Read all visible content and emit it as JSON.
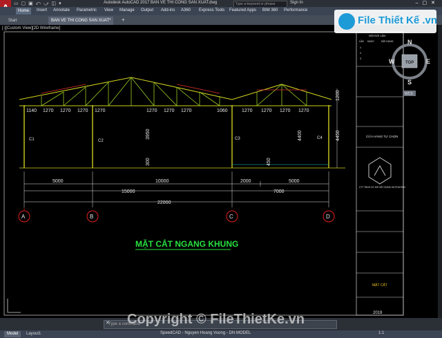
{
  "app": {
    "title": "Autodesk AutoCAD 2017   BAN VE THI CONG SAN XUAT.dwg",
    "search_placeholder": "Type a keyword or phrase",
    "signin": "Sign In",
    "logo_letter": "A"
  },
  "ribbon": {
    "tabs": [
      "Home",
      "Insert",
      "Annotate",
      "Parametric",
      "View",
      "Manage",
      "Output",
      "Add-ins",
      "A360",
      "Express Tools",
      "Featured Apps",
      "BIM 360",
      "Performance"
    ],
    "active_tab": "Home"
  },
  "doc_tabs": [
    "Start",
    "BAN VE THI CONG SAN XUAT*"
  ],
  "viewport_label": "[-][Custom View][2D Wireframe]",
  "viewcube": {
    "n": "N",
    "s": "S",
    "e": "E",
    "w": "W",
    "top": "TOP",
    "wcs": "WCS"
  },
  "drawing": {
    "heading": "MẶT CẮT NGANG KHUNG",
    "heading_color": "#28e040",
    "frame_color": "#cfcf20",
    "dim_color": "#e8e8e8",
    "axis_color": "#e02020",
    "axes": [
      "A",
      "B",
      "C",
      "D"
    ],
    "column_labels": [
      "C1",
      "C2",
      "C3",
      "C4"
    ],
    "panel_dims": [
      "1140",
      "1270",
      "1270",
      "1270",
      "1270",
      "1270",
      "1270",
      "1270",
      "1060",
      "1270",
      "1270",
      "1270",
      "1270"
    ],
    "heights": [
      "3950",
      "4400",
      "4450",
      "1200"
    ],
    "small_dims": [
      "300",
      "450"
    ],
    "span_dims_row1": [
      "5000",
      "10000",
      "2000",
      "5000"
    ],
    "span_dims_row2": [
      "15000",
      "7000"
    ],
    "total_dim": "22000"
  },
  "title_block": {
    "revision_header": "NỘI ĐỔI LẦN",
    "revision_cols": [
      "LẦN",
      "NGÀY",
      "NỘI DUNG"
    ],
    "revision_rows": [
      "1",
      "2",
      "3"
    ],
    "project_value": "CỬA HÀNG TỰ CHỌN",
    "company": "CTY TNHH CƠ KHÍ XÂY DỰNG HÀ PHƯƠNG",
    "sheet_title": "MẶT CẮT",
    "year": "2019"
  },
  "command": {
    "placeholder": "Type a command",
    "close": "✕"
  },
  "status": {
    "tabs": [
      "Model",
      "Layout1"
    ],
    "active": "Model",
    "info": "SpeedCAD - Nguyen Hoang Vuong - DN     MODEL",
    "scale": "1:1"
  },
  "watermarks": {
    "top": "File Thiết Kế .vn",
    "bottom": "Copyright © FileThietKe.vn"
  }
}
